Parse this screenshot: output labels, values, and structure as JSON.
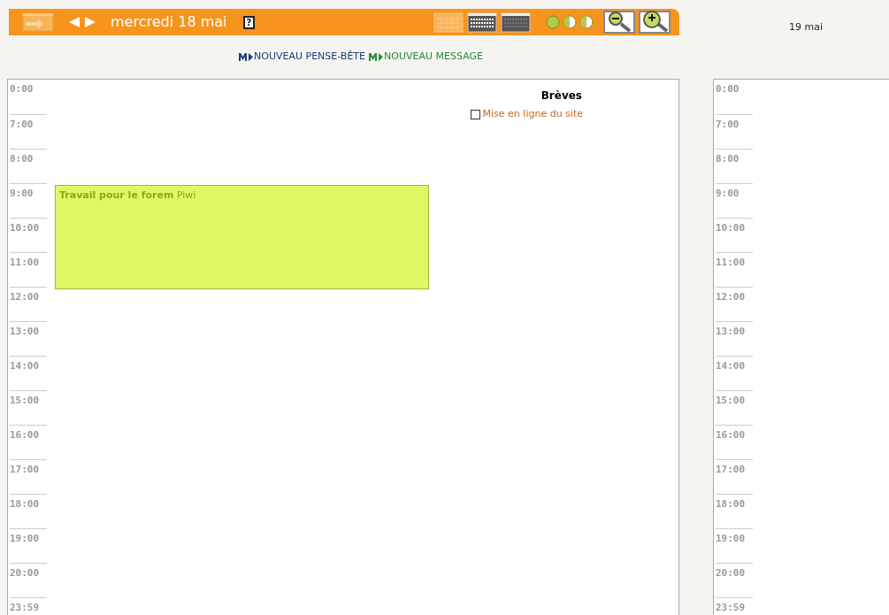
{
  "header": {
    "title": "mercredi 18 mai",
    "help": "?"
  },
  "links": [
    {
      "label": "NOUVEAU PENSE-BÊTE",
      "color": "#1d3f7a"
    },
    {
      "label": "NOUVEAU MESSAGE",
      "color": "#2b8a3e"
    }
  ],
  "day": {
    "hours": [
      "0:00",
      "7:00",
      "8:00",
      "9:00",
      "10:00",
      "11:00",
      "12:00",
      "13:00",
      "14:00",
      "15:00",
      "16:00",
      "17:00",
      "18:00",
      "19:00",
      "20:00",
      "23:59"
    ],
    "event": {
      "title": "Travail pour le forem",
      "owner": "Piwi"
    },
    "breves": {
      "title": "Brèves",
      "items": [
        {
          "label": "Mise en ligne du site",
          "checked": false
        }
      ]
    }
  },
  "next_day": {
    "title": "19 mai",
    "hours": [
      "0:00",
      "7:00",
      "8:00",
      "9:00",
      "10:00",
      "11:00",
      "12:00",
      "13:00",
      "14:00",
      "15:00",
      "16:00",
      "17:00",
      "18:00",
      "19:00",
      "20:00",
      "23:59"
    ]
  }
}
